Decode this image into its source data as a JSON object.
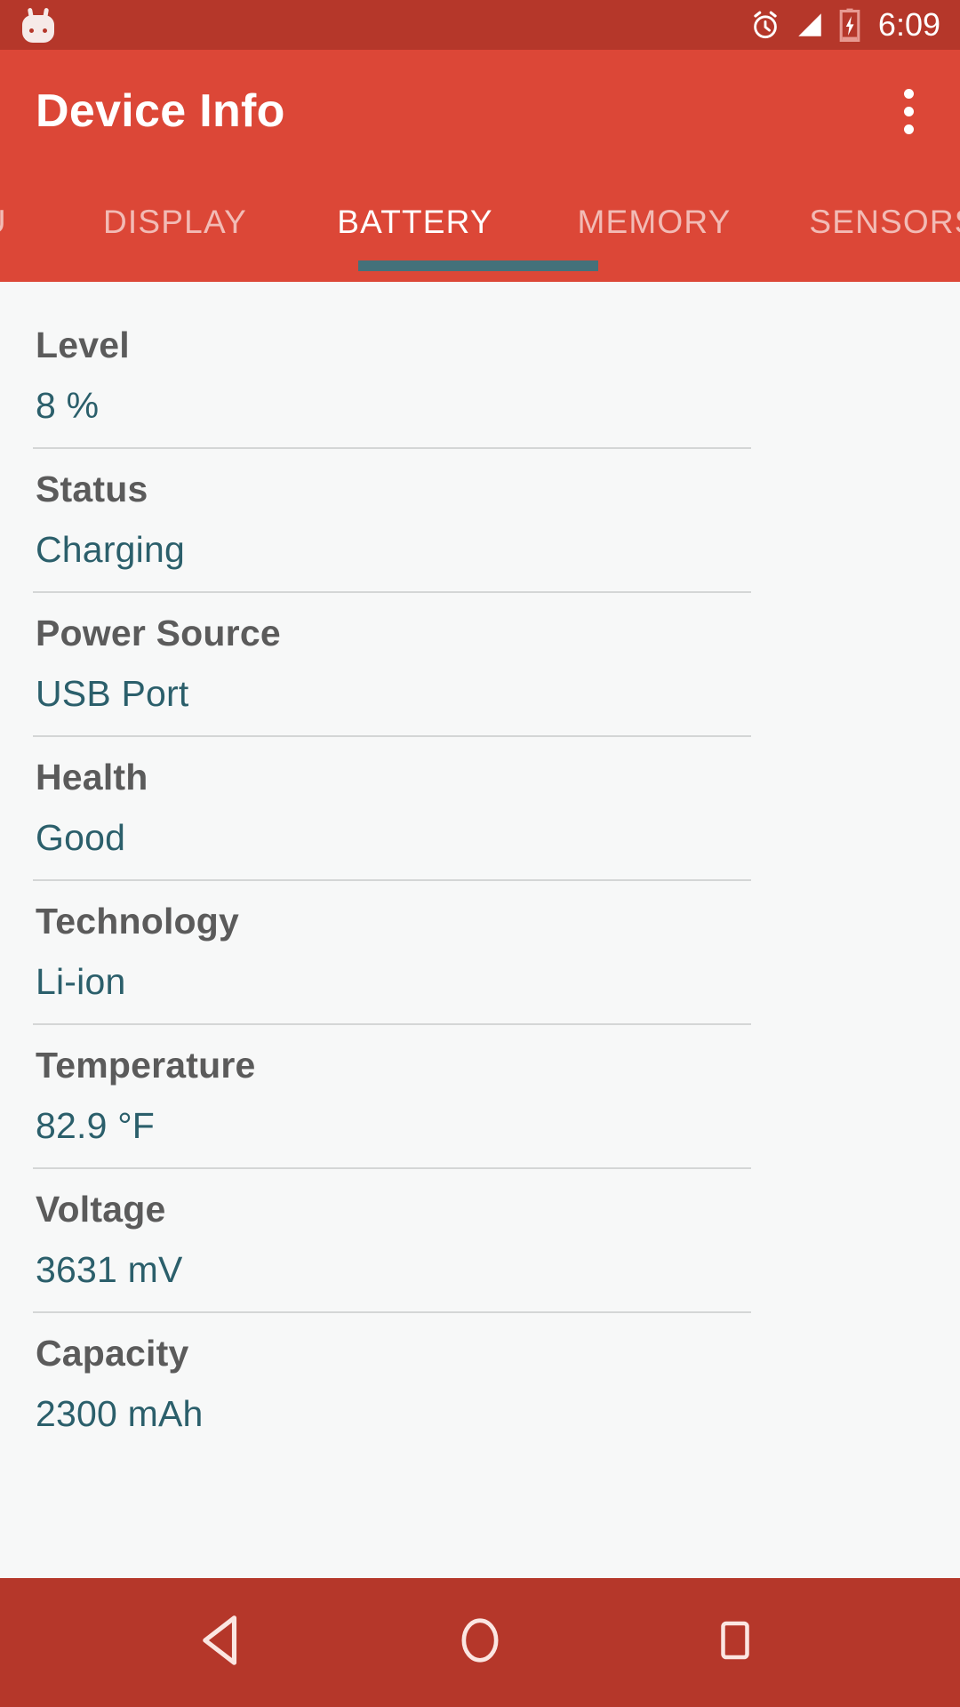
{
  "status_bar": {
    "icons": [
      "android-droid-icon",
      "alarm-icon",
      "signal-icon",
      "battery-charging-icon"
    ],
    "time": "6:09"
  },
  "appbar": {
    "title": "Device Info",
    "overflow_label": "more-options"
  },
  "tabs": {
    "items": [
      {
        "label": "CPU",
        "active": false
      },
      {
        "label": "DISPLAY",
        "active": false
      },
      {
        "label": "BATTERY",
        "active": true
      },
      {
        "label": "MEMORY",
        "active": false
      },
      {
        "label": "SENSORS",
        "active": false
      }
    ],
    "active_index": 2,
    "indicator_color": "#44717a"
  },
  "battery": {
    "rows": [
      {
        "label": "Level",
        "value": "8 %"
      },
      {
        "label": "Status",
        "value": "Charging"
      },
      {
        "label": "Power Source",
        "value": "USB Port"
      },
      {
        "label": "Health",
        "value": "Good"
      },
      {
        "label": "Technology",
        "value": "Li-ion"
      },
      {
        "label": "Temperature",
        "value": "82.9 °F"
      },
      {
        "label": "Voltage",
        "value": "3631 mV"
      },
      {
        "label": "Capacity",
        "value": "2300 mAh"
      }
    ]
  },
  "navbar": {
    "back": "back-button",
    "home": "home-button",
    "recents": "recents-button"
  },
  "colors": {
    "status_bar": "#b5372a",
    "appbar": "#dc4737",
    "accent_teal": "#2b5f6b",
    "label_gray": "#5b5b5b",
    "content_bg": "#f7f8f8"
  }
}
